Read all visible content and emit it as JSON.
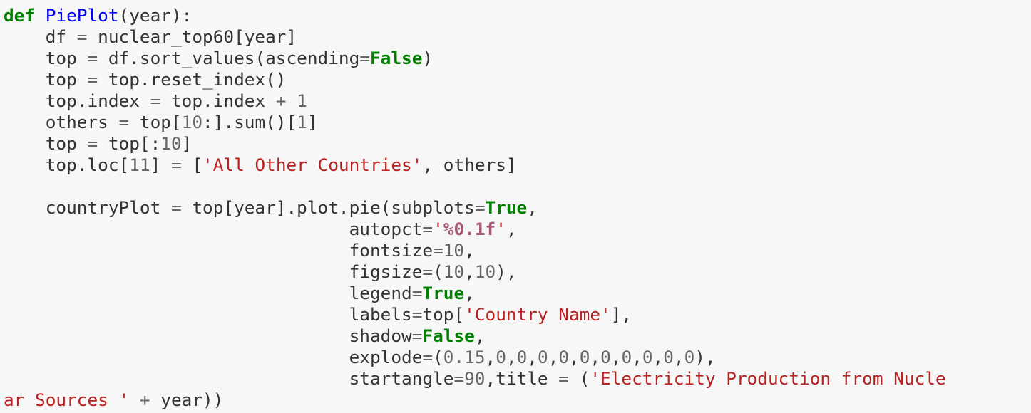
{
  "cell": {
    "language": "python",
    "lines": [
      [
        [
          "kw",
          "def"
        ],
        [
          "plain",
          " "
        ],
        [
          "fn",
          "PiePlot"
        ],
        [
          "plain",
          "(year):"
        ]
      ],
      [
        [
          "plain",
          "    df "
        ],
        [
          "op",
          "="
        ],
        [
          "plain",
          " nuclear_top60[year]"
        ]
      ],
      [
        [
          "plain",
          "    top "
        ],
        [
          "op",
          "="
        ],
        [
          "plain",
          " df.sort_values(ascending"
        ],
        [
          "op",
          "="
        ],
        [
          "kw",
          "False"
        ],
        [
          "plain",
          ")"
        ]
      ],
      [
        [
          "plain",
          "    top "
        ],
        [
          "op",
          "="
        ],
        [
          "plain",
          " top.reset_index()"
        ]
      ],
      [
        [
          "plain",
          "    top.index "
        ],
        [
          "op",
          "="
        ],
        [
          "plain",
          " top.index "
        ],
        [
          "op",
          "+"
        ],
        [
          "plain",
          " "
        ],
        [
          "num",
          "1"
        ]
      ],
      [
        [
          "plain",
          "    others "
        ],
        [
          "op",
          "="
        ],
        [
          "plain",
          " top["
        ],
        [
          "num",
          "10"
        ],
        [
          "plain",
          ":].sum()["
        ],
        [
          "num",
          "1"
        ],
        [
          "plain",
          "]"
        ]
      ],
      [
        [
          "plain",
          "    top "
        ],
        [
          "op",
          "="
        ],
        [
          "plain",
          " top[:"
        ],
        [
          "num",
          "10"
        ],
        [
          "plain",
          "]"
        ]
      ],
      [
        [
          "plain",
          "    top.loc["
        ],
        [
          "num",
          "11"
        ],
        [
          "plain",
          "] "
        ],
        [
          "op",
          "="
        ],
        [
          "plain",
          " ["
        ],
        [
          "str",
          "'All Other Countries'"
        ],
        [
          "plain",
          ", others]"
        ]
      ],
      [
        [
          "plain",
          ""
        ]
      ],
      [
        [
          "plain",
          "    countryPlot "
        ],
        [
          "op",
          "="
        ],
        [
          "plain",
          " top[year].plot.pie(subplots"
        ],
        [
          "op",
          "="
        ],
        [
          "kw",
          "True"
        ],
        [
          "plain",
          ","
        ]
      ],
      [
        [
          "plain",
          "                                 autopct"
        ],
        [
          "op",
          "="
        ],
        [
          "str",
          "'"
        ],
        [
          "fmt",
          "%0.1f"
        ],
        [
          "str",
          "'"
        ],
        [
          "plain",
          ","
        ]
      ],
      [
        [
          "plain",
          "                                 fontsize"
        ],
        [
          "op",
          "="
        ],
        [
          "num",
          "10"
        ],
        [
          "plain",
          ","
        ]
      ],
      [
        [
          "plain",
          "                                 figsize"
        ],
        [
          "op",
          "="
        ],
        [
          "plain",
          "("
        ],
        [
          "num",
          "10"
        ],
        [
          "plain",
          ","
        ],
        [
          "num",
          "10"
        ],
        [
          "plain",
          "),"
        ]
      ],
      [
        [
          "plain",
          "                                 legend"
        ],
        [
          "op",
          "="
        ],
        [
          "kw",
          "True"
        ],
        [
          "plain",
          ","
        ]
      ],
      [
        [
          "plain",
          "                                 labels"
        ],
        [
          "op",
          "="
        ],
        [
          "plain",
          "top["
        ],
        [
          "str",
          "'Country Name'"
        ],
        [
          "plain",
          "],"
        ]
      ],
      [
        [
          "plain",
          "                                 shadow"
        ],
        [
          "op",
          "="
        ],
        [
          "kw",
          "False"
        ],
        [
          "plain",
          ","
        ]
      ],
      [
        [
          "plain",
          "                                 explode"
        ],
        [
          "op",
          "="
        ],
        [
          "plain",
          "("
        ],
        [
          "num",
          "0.15"
        ],
        [
          "plain",
          ","
        ],
        [
          "num",
          "0"
        ],
        [
          "plain",
          ","
        ],
        [
          "num",
          "0"
        ],
        [
          "plain",
          ","
        ],
        [
          "num",
          "0"
        ],
        [
          "plain",
          ","
        ],
        [
          "num",
          "0"
        ],
        [
          "plain",
          ","
        ],
        [
          "num",
          "0"
        ],
        [
          "plain",
          ","
        ],
        [
          "num",
          "0"
        ],
        [
          "plain",
          ","
        ],
        [
          "num",
          "0"
        ],
        [
          "plain",
          ","
        ],
        [
          "num",
          "0"
        ],
        [
          "plain",
          ","
        ],
        [
          "num",
          "0"
        ],
        [
          "plain",
          ","
        ],
        [
          "num",
          "0"
        ],
        [
          "plain",
          "),"
        ]
      ],
      [
        [
          "plain",
          "                                 startangle"
        ],
        [
          "op",
          "="
        ],
        [
          "num",
          "90"
        ],
        [
          "plain",
          ",title "
        ],
        [
          "op",
          "="
        ],
        [
          "plain",
          " ("
        ],
        [
          "str",
          "'Electricity Production from Nucle"
        ]
      ],
      [
        [
          "str",
          "ar Sources '"
        ],
        [
          "plain",
          " "
        ],
        [
          "op",
          "+"
        ],
        [
          "plain",
          " year))"
        ]
      ]
    ]
  },
  "colors": {
    "background": "#f7f7f7",
    "keyword": "#008000",
    "function_name": "#0000ff",
    "string": "#ba2121",
    "format_spec": "#a45a77",
    "number": "#666666",
    "text": "#333333"
  }
}
